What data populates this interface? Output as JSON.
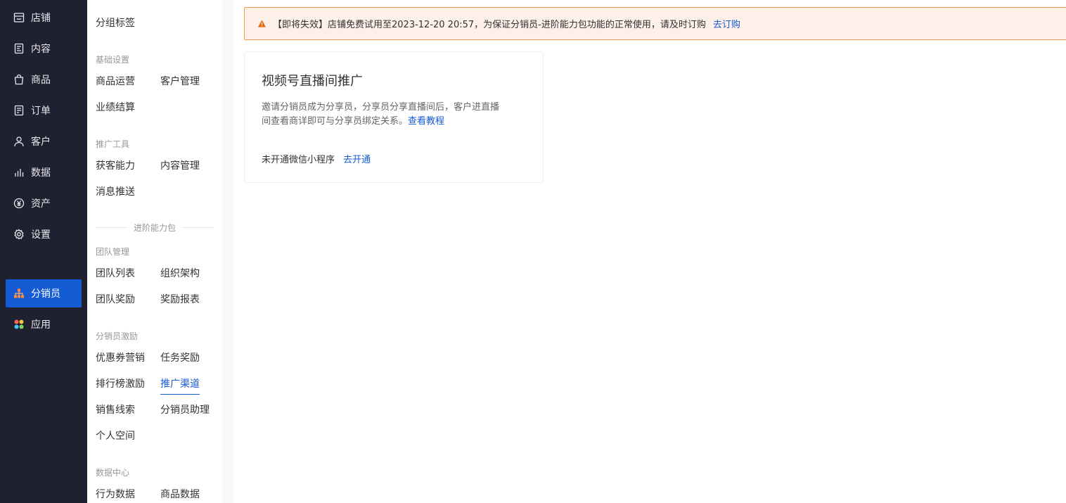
{
  "primary_nav": {
    "items": [
      {
        "label": "店铺",
        "icon": "store-icon"
      },
      {
        "label": "内容",
        "icon": "document-icon"
      },
      {
        "label": "商品",
        "icon": "bag-icon"
      },
      {
        "label": "订单",
        "icon": "order-icon"
      },
      {
        "label": "客户",
        "icon": "user-icon"
      },
      {
        "label": "数据",
        "icon": "bar-chart-icon"
      },
      {
        "label": "资产",
        "icon": "yuan-icon"
      },
      {
        "label": "设置",
        "icon": "gear-icon"
      },
      {
        "label": "分销员",
        "icon": "org-chart-icon"
      },
      {
        "label": "应用",
        "icon": "apps-icon"
      }
    ],
    "active": "分销员"
  },
  "secondary_nav": {
    "top_item": "分组标签",
    "groups": {
      "basic": {
        "title": "基础设置",
        "items": [
          "商品运营",
          "客户管理",
          "业绩结算"
        ]
      },
      "promo": {
        "title": "推广工具",
        "items": [
          "获客能力",
          "内容管理",
          "消息推送"
        ]
      },
      "divider": "进阶能力包",
      "team": {
        "title": "团队管理",
        "items": [
          "团队列表",
          "组织架构",
          "团队奖励",
          "奖励报表"
        ]
      },
      "incentive": {
        "title": "分销员激励",
        "items": [
          "优惠券营销",
          "任务奖励",
          "排行榜激励",
          "推广渠道",
          "销售线索",
          "分销员助理",
          "个人空间"
        ]
      },
      "data": {
        "title": "数据中心",
        "items": [
          "行为数据",
          "商品数据"
        ]
      }
    },
    "active": "推广渠道"
  },
  "notice": {
    "text": "【即将失效】店铺免费试用至2023-12-20 20:57，为保证分销员-进阶能力包功能的正常使用，请及时订购",
    "link": "去订购"
  },
  "card": {
    "title": "视频号直播间推广",
    "desc_line1": "邀请分销员成为分享员，分享员分享直播间后，客户进直播",
    "desc_line2": "间查看商详即可与分享员绑定关系。",
    "desc_link": "查看教程",
    "status_text": "未开通微信小程序",
    "status_link": "去开通"
  },
  "colors": {
    "sidebar_bg": "#1f2030",
    "active_bg": "#155bd4",
    "link": "#155bd4",
    "notice_bg": "#fdf0e8",
    "notice_border": "#ee9a4a",
    "warning_icon": "#ed6a0c"
  }
}
